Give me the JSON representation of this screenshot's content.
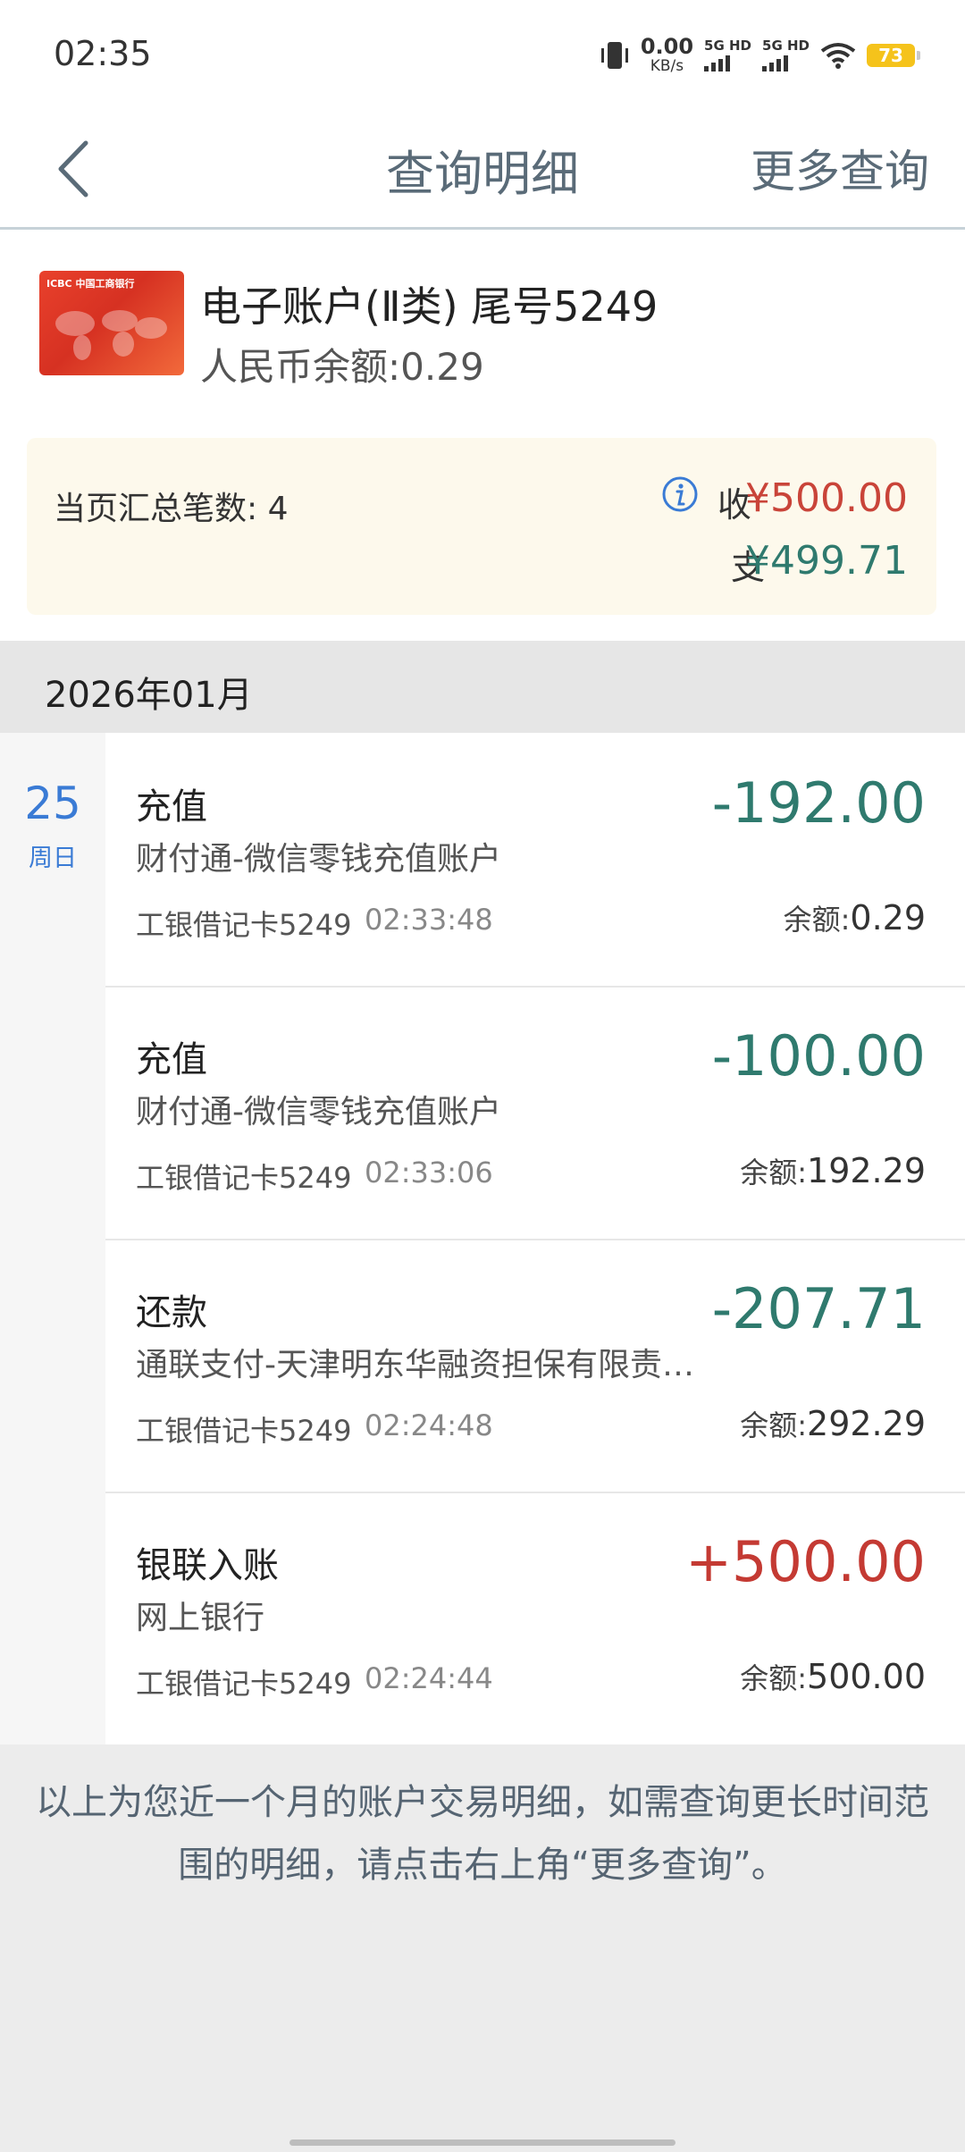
{
  "status_bar": {
    "time": "02:35",
    "net_speed_value": "0.00",
    "net_speed_unit": "KB/s",
    "sim1_label": "5G HD",
    "sim2_label": "5G HD",
    "battery": "73",
    "icons": [
      "vibrate-icon",
      "signal-icon",
      "wifi-icon",
      "battery-icon"
    ]
  },
  "nav": {
    "back_icon": "chevron-left-icon",
    "title": "查询明细",
    "more": "更多查询"
  },
  "account": {
    "card_logo": "ICBC 中国工商银行",
    "name": "电子账户(Ⅱ类) 尾号5249",
    "balance": "人民币余额:0.29"
  },
  "summary": {
    "count_text": "当页汇总笔数: 4",
    "income_label": "收",
    "income_amount": "¥500.00",
    "expense_label": "支",
    "expense_amount": "¥499.71",
    "info_icon": "info-icon"
  },
  "month": "2026年01月",
  "day": {
    "date": "25",
    "weekday": "周日"
  },
  "transactions": [
    {
      "type": "充值",
      "desc": "财付通-微信零钱充值账户",
      "card": "工银借记卡5249",
      "time": "02:33:48",
      "amount": "-192.00",
      "balance_label": "余额:",
      "balance": "0.29"
    },
    {
      "type": "充值",
      "desc": "财付通-微信零钱充值账户",
      "card": "工银借记卡5249",
      "time": "02:33:06",
      "amount": "-100.00",
      "balance_label": "余额:",
      "balance": "192.29"
    },
    {
      "type": "还款",
      "desc": "通联支付-天津明东华融资担保有限责…",
      "card": "工银借记卡5249",
      "time": "02:24:48",
      "amount": "-207.71",
      "balance_label": "余额:",
      "balance": "292.29"
    },
    {
      "type": "银联入账",
      "desc": "网上银行",
      "card": "工银借记卡5249",
      "time": "02:24:44",
      "amount": "+500.00",
      "balance_label": "余额:",
      "balance": "500.00"
    }
  ],
  "note": "以上为您近一个月的账户交易明细，如需查询更长时间范围的明细，请点击右上角“更多查询”。",
  "colors": {
    "expense": "#2f7a6e",
    "income": "#c43a33",
    "date": "#3a7bd5"
  }
}
